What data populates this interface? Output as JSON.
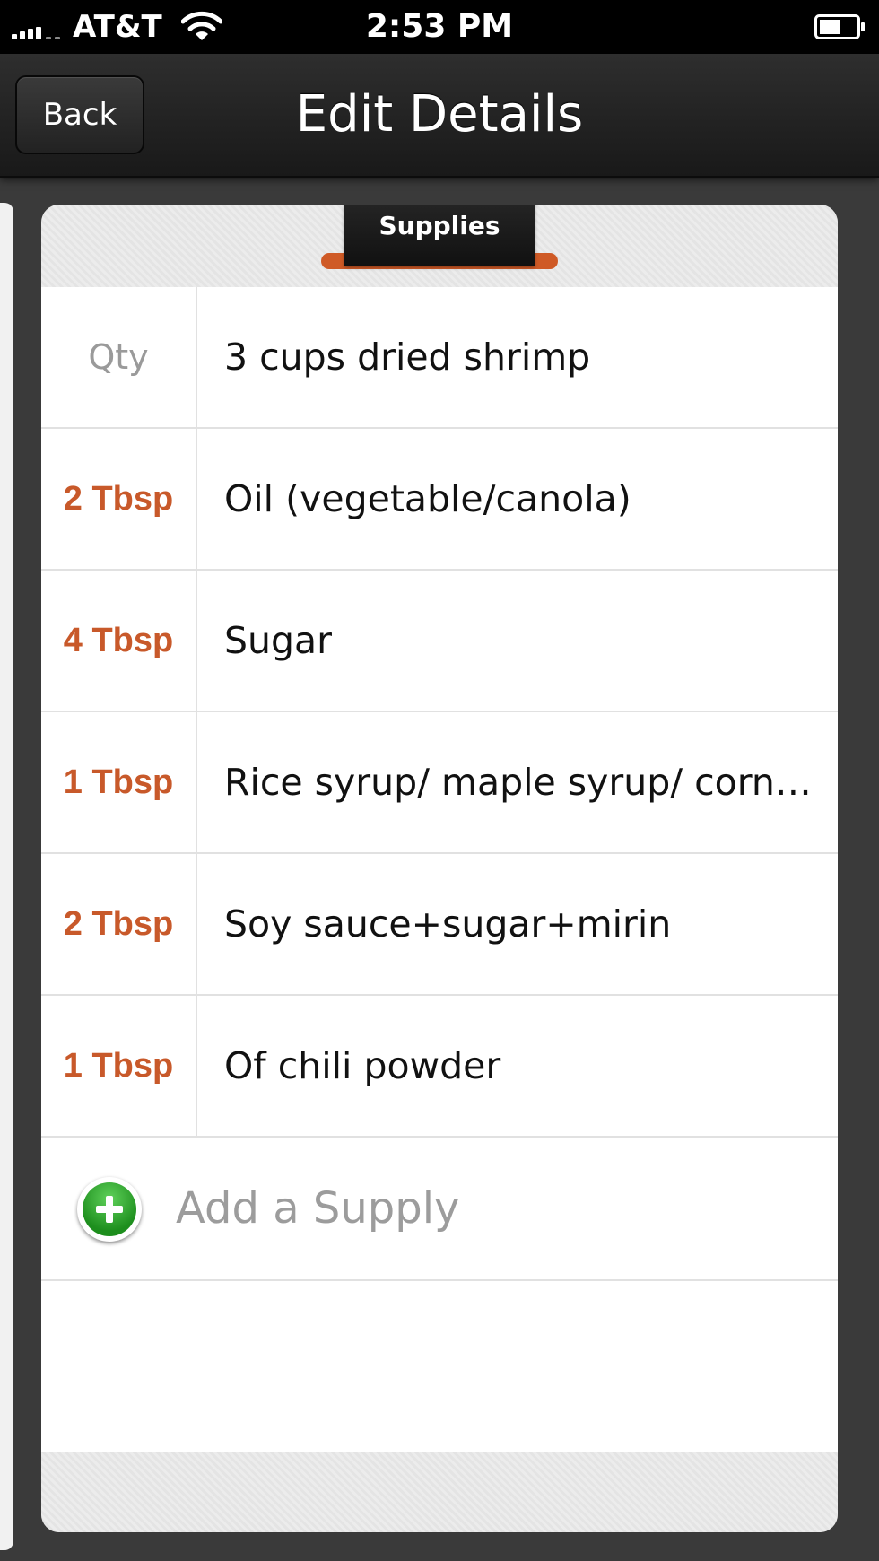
{
  "status_bar": {
    "carrier": "AT&T",
    "time": "2:53 PM",
    "signal_icon": "signal-bars-icon",
    "wifi_icon": "wifi-icon",
    "battery_icon": "battery-icon"
  },
  "nav": {
    "back_label": "Back",
    "title": "Edit Details"
  },
  "section": {
    "tab_label": "Supplies",
    "accent_color": "#cf5a26"
  },
  "supplies": [
    {
      "qty": "Qty",
      "name": "3 cups dried shrimp"
    },
    {
      "qty": "2 Tbsp",
      "name": "Oil (vegetable/canola)"
    },
    {
      "qty": "4 Tbsp",
      "name": "Sugar"
    },
    {
      "qty": "1 Tbsp",
      "name": "Rice syrup/ maple syrup/ corn…"
    },
    {
      "qty": "2 Tbsp",
      "name": "Soy sauce+sugar+mirin"
    },
    {
      "qty": "1 Tbsp",
      "name": "Of chili powder"
    }
  ],
  "add_supply": {
    "label": "Add a Supply",
    "icon": "add-circle-icon"
  }
}
